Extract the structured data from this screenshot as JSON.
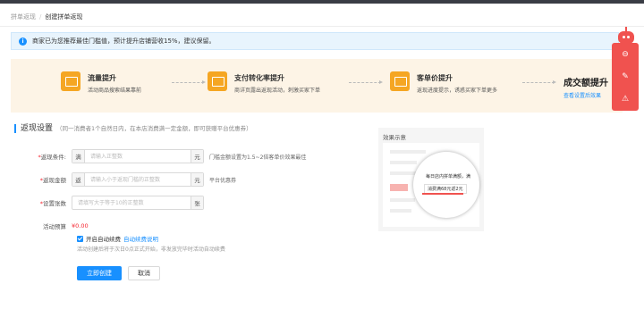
{
  "breadcrumb": {
    "parent": "拼单返现",
    "separator": "/",
    "current": "创建拼单返现"
  },
  "notice": {
    "text": "商家已为您推荐最佳门槛值，预计提升店铺营收15%，建议保留。"
  },
  "steps": [
    {
      "title": "流量提升",
      "desc": "活动商品搜索结果靠前"
    },
    {
      "title": "支付转化率提升",
      "desc": "商详页露出返现活动，刺激买家下单"
    },
    {
      "title": "客单价提升",
      "desc": "返现进度提示，诱惑买家下单更多"
    }
  ],
  "final": {
    "title": "成交额提升",
    "link": "查看设置后效果"
  },
  "section": {
    "title": "返现设置",
    "hint": "（同一消费者1个自然日内，在本店消费满一定金额，即可获赠平台优惠券）"
  },
  "form": {
    "condition": {
      "label": "返现条件:",
      "prefix": "满",
      "placeholder": "请输入正整数",
      "suffix": "元",
      "tip": "门槛金额设置为1.5~2倍客单价效果最佳"
    },
    "amount": {
      "label": "返现金额",
      "prefix": "返",
      "placeholder": "请输入小于返现门槛的正整数",
      "suffix": "元",
      "tip": "平台优惠券"
    },
    "count": {
      "label": "设置张数",
      "placeholder": "请填写大于等于10的正整数",
      "suffix": "张"
    },
    "budget": {
      "label": "活动预算",
      "value": "¥0.00"
    },
    "auto_renew": {
      "label": "开启自动续费",
      "link": "自动续费说明",
      "checked": true
    },
    "note": "活动创建后将于次日0点正式开始，非发放完毕时活动自动续费"
  },
  "buttons": {
    "create": "立即创建",
    "cancel": "取消"
  },
  "preview": {
    "title": "效果示意",
    "line1": "每日店内拼单满额，满",
    "line2": "消费满68元返2元"
  },
  "colors": {
    "primary": "#1890ff",
    "accent_red": "#f0524f",
    "step_bg": "#fdf4e6",
    "step_icon": "#f5a623"
  }
}
